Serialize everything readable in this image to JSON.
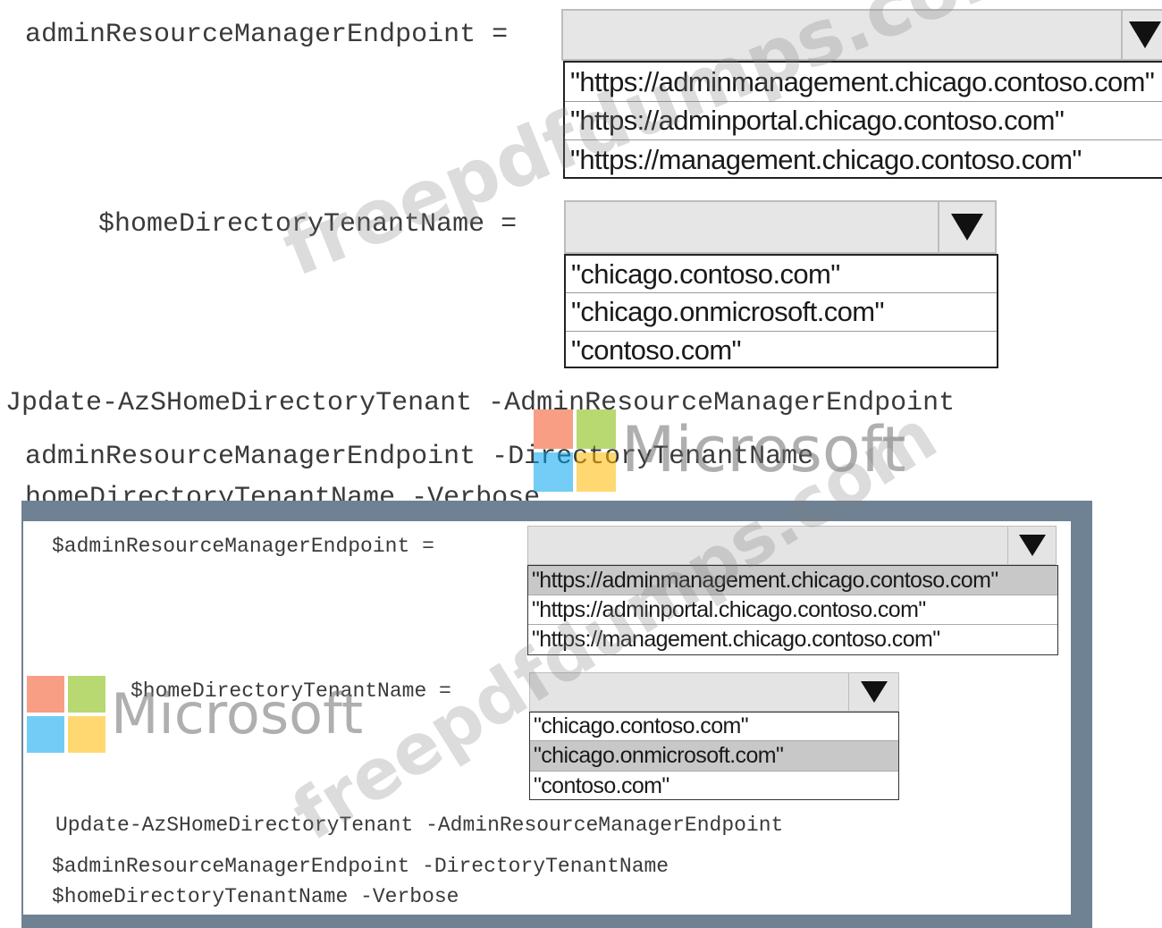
{
  "question": {
    "admin_label": "adminResourceManagerEndpoint =",
    "admin_options": [
      "\"https://adminmanagement.chicago.contoso.com\"",
      "\"https://adminportal.chicago.contoso.com\"",
      "\"https://management.chicago.contoso.com\""
    ],
    "tenant_label": "$homeDirectoryTenantName =",
    "tenant_options": [
      "\"chicago.contoso.com\"",
      "\"chicago.onmicrosoft.com\"",
      "\"contoso.com\""
    ],
    "command_lines": [
      "Jpdate-AzSHomeDirectoryTenant -AdminResourceManagerEndpoint",
      "adminResourceManagerEndpoint -DirectoryTenantName",
      "homeDirectoryTenantName -Verbose"
    ]
  },
  "answer": {
    "admin_label": "$adminResourceManagerEndpoint =",
    "admin_options": [
      "\"https://adminmanagement.chicago.contoso.com\"",
      "\"https://adminportal.chicago.contoso.com\"",
      "\"https://management.chicago.contoso.com\""
    ],
    "admin_selected_index": 0,
    "tenant_label": "$homeDirectoryTenantName =",
    "tenant_options": [
      "\"chicago.contoso.com\"",
      "\"chicago.onmicrosoft.com\"",
      "\"contoso.com\""
    ],
    "tenant_selected_index": 1,
    "command_lines": [
      "Update-AzSHomeDirectoryTenant -AdminResourceManagerEndpoint",
      "$adminResourceManagerEndpoint -DirectoryTenantName",
      "$homeDirectoryTenantName -Verbose"
    ]
  },
  "watermarks": {
    "site_text": "freepdfdumps.com",
    "brand_text": "Microsoft"
  },
  "colors": {
    "frame": "#6e8294",
    "selected_option": "#c8c8c8",
    "ms_red": "#f25022",
    "ms_green": "#7fba00",
    "ms_blue": "#00a4ef",
    "ms_yellow": "#ffb900"
  }
}
